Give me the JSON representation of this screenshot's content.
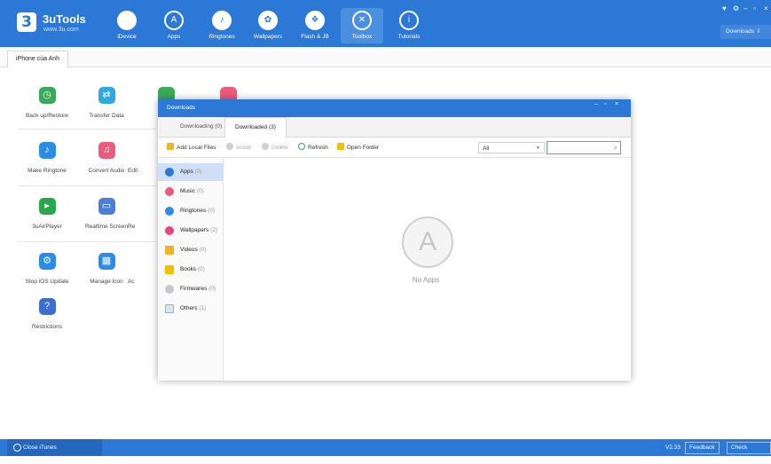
{
  "app": {
    "title": "3uTools",
    "url": "www.3u.com",
    "logo": "3"
  },
  "nav_tabs": [
    {
      "label": "iDevice",
      "icon": "apple-icon"
    },
    {
      "label": "Apps",
      "icon": "appstore-icon"
    },
    {
      "label": "Ringtones",
      "icon": "bell-icon"
    },
    {
      "label": "Wallpapers",
      "icon": "flower-icon"
    },
    {
      "label": "Flash & JB",
      "icon": "dropbox-icon"
    },
    {
      "label": "Toolbox",
      "icon": "tools-icon"
    },
    {
      "label": "Tutorials",
      "icon": "info-icon"
    }
  ],
  "active_nav": "Toolbox",
  "window_controls": {
    "skin": "♥",
    "settings": "⚙",
    "minimize": "–",
    "maximize": "▫",
    "close": "×"
  },
  "downloads_button": "Downloads ⇩",
  "device_tab": "iPhone của Anh",
  "tools": [
    {
      "label": "Back up/Restore",
      "icon": "clock-icon",
      "color": "#3aaa5a"
    },
    {
      "label": "Transfer Data",
      "icon": "transfer-icon",
      "color": "#2ea8e0"
    },
    {
      "label": "Make Ringtone",
      "icon": "bell-icon",
      "color": "#2b8de8"
    },
    {
      "label": "Convert Audio",
      "icon": "music-icon",
      "color": "#ec5a7c"
    },
    {
      "label": "Edit",
      "icon": "edit-icon",
      "color": "#3aaa5a"
    },
    {
      "label": "3uAirPlayer",
      "icon": "play-icon",
      "color": "#27a84a"
    },
    {
      "label": "Realtime Screen",
      "icon": "monitor-icon",
      "color": "#4b7fd6"
    },
    {
      "label": "Re",
      "icon": "unknown-icon",
      "color": "#888888"
    },
    {
      "label": "Stop iOS Update",
      "icon": "gear-icon",
      "color": "#2b8de8"
    },
    {
      "label": "Manage Icon",
      "icon": "grid-icon",
      "color": "#2b8de8"
    },
    {
      "label": "Ac",
      "icon": "unknown-icon",
      "color": "#888888"
    },
    {
      "label": "Restrictions",
      "icon": "key-icon",
      "color": "#3d6fd0"
    }
  ],
  "downloads_dialog": {
    "title": "Downloads",
    "tabs": [
      {
        "label": "Downloading (0)"
      },
      {
        "label": "Downloaded (3)"
      }
    ],
    "active_tab": "Downloaded (3)",
    "toolbar": {
      "add_local": "Add Local Files",
      "install": "Install",
      "delete": "Delete",
      "refresh": "Refresh",
      "open_folder": "Open Folder",
      "filter_value": "All",
      "search_placeholder": ""
    },
    "categories": [
      {
        "label": "Apps",
        "count": "(0)",
        "color": "#2b78d6"
      },
      {
        "label": "Music",
        "count": "(0)",
        "color": "#ec5a7c"
      },
      {
        "label": "Ringtones",
        "count": "(0)",
        "color": "#2b8de8"
      },
      {
        "label": "Wallpapers",
        "count": "(2)",
        "color": "#e8457a"
      },
      {
        "label": "Videos",
        "count": "(0)",
        "color": "#f0b42a"
      },
      {
        "label": "Books",
        "count": "(0)",
        "color": "#f2c200"
      },
      {
        "label": "Firmwares",
        "count": "(0)",
        "color": "#9aa0a8"
      },
      {
        "label": "Others",
        "count": "(1)",
        "color": "#7f8c99"
      }
    ],
    "empty_text": "No Apps"
  },
  "statusbar": {
    "close_itunes": "Close iTunes",
    "version": "V2.33",
    "feedback": "Feedback",
    "check_update": "Check Update"
  }
}
